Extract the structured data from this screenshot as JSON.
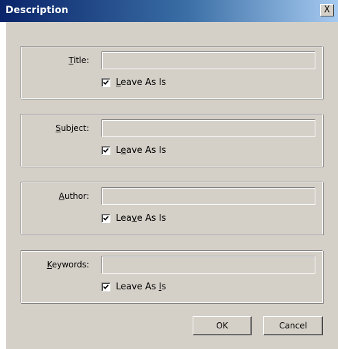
{
  "window": {
    "title": "Description",
    "close_glyph": "X"
  },
  "groups": [
    {
      "label_pre": "",
      "label_ul": "T",
      "label_post": "itle:",
      "value": "",
      "leave_pre": "",
      "leave_ul": "L",
      "leave_post": "eave As Is",
      "checked": true
    },
    {
      "label_pre": "",
      "label_ul": "S",
      "label_post": "ubject:",
      "value": "",
      "leave_pre": "L",
      "leave_ul": "e",
      "leave_post": "ave As Is",
      "checked": true
    },
    {
      "label_pre": "",
      "label_ul": "A",
      "label_post": "uthor:",
      "value": "",
      "leave_pre": "Lea",
      "leave_ul": "v",
      "leave_post": "e As Is",
      "checked": true
    },
    {
      "label_pre": "",
      "label_ul": "K",
      "label_post": "eywords:",
      "value": "",
      "leave_pre": "Leave As ",
      "leave_ul": "I",
      "leave_post": "s",
      "checked": true
    }
  ],
  "buttons": {
    "ok": "OK",
    "cancel": "Cancel"
  },
  "colors": {
    "face": "#d4d0c8",
    "title_start": "#0a246a",
    "title_end": "#a6caf0"
  }
}
